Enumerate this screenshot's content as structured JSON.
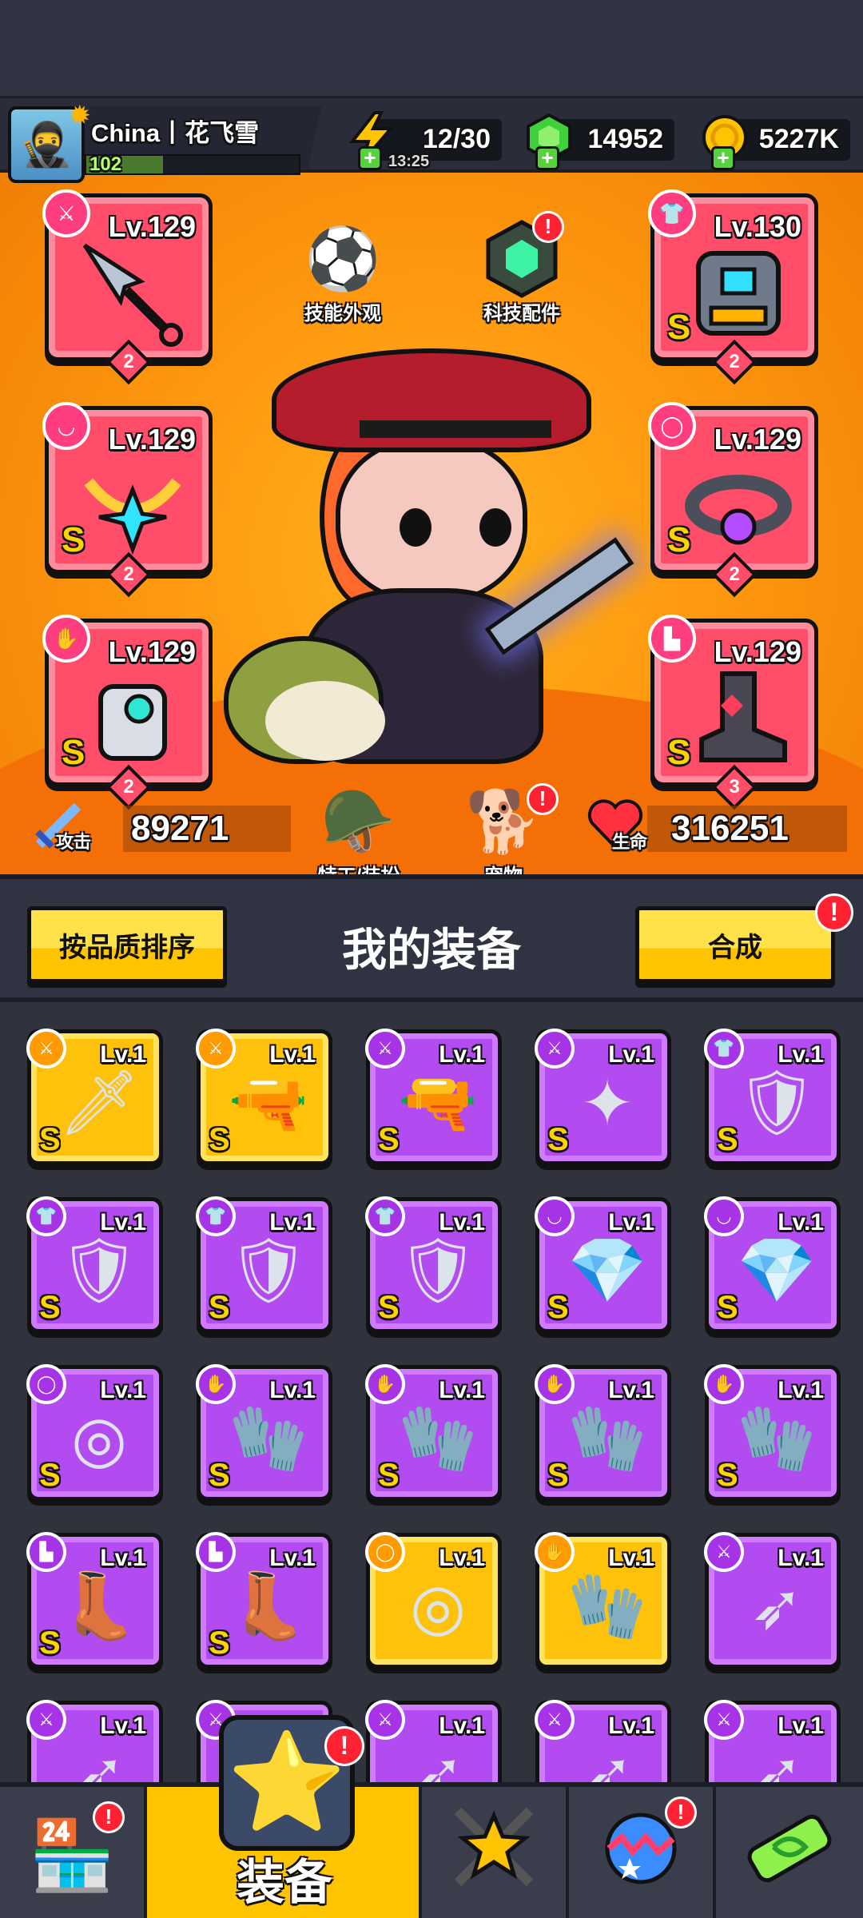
{
  "player": {
    "name": "China丨花飞雪",
    "level": "102",
    "avatar_icon": "ninja-avatar"
  },
  "resources": {
    "energy": {
      "value": "12/30",
      "timer": "13:25",
      "icon": "lightning-icon"
    },
    "gems": {
      "value": "14952",
      "icon": "green-gem-icon"
    },
    "coins": {
      "value": "5227K",
      "icon": "gold-coin-icon"
    }
  },
  "equipped": [
    {
      "slot": "weapon",
      "level": "Lv.129",
      "stars": "2",
      "grade": "",
      "icon": "kunai-icon"
    },
    {
      "slot": "armor",
      "level": "Lv.130",
      "stars": "2",
      "grade": "S",
      "icon": "armor-icon"
    },
    {
      "slot": "necklace",
      "level": "Lv.129",
      "stars": "2",
      "grade": "S",
      "icon": "necklace-icon"
    },
    {
      "slot": "belt",
      "level": "Lv.129",
      "stars": "2",
      "grade": "S",
      "icon": "belt-icon"
    },
    {
      "slot": "gloves",
      "level": "Lv.129",
      "stars": "2",
      "grade": "S",
      "icon": "glove-icon"
    },
    {
      "slot": "boots",
      "level": "Lv.129",
      "stars": "3",
      "grade": "S",
      "icon": "boot-icon"
    }
  ],
  "center_buttons": {
    "skill_skin": "技能外观",
    "tech_parts": "科技配件",
    "agent_outfit": "特工/装扮",
    "pet": "宠物"
  },
  "stats": {
    "attack_label": "攻击",
    "attack_value": "89271",
    "hp_label": "生命",
    "hp_value": "316251"
  },
  "equip_header": {
    "sort_label": "按品质排序",
    "title": "我的装备",
    "merge_label": "合成"
  },
  "inventory": [
    {
      "level": "Lv.1",
      "grade": "S",
      "rarity": "gold",
      "icon": "sword-icon"
    },
    {
      "level": "Lv.1",
      "grade": "S",
      "rarity": "gold",
      "icon": "water-gun-icon"
    },
    {
      "level": "Lv.1",
      "grade": "S",
      "rarity": "purple",
      "icon": "water-gun-icon"
    },
    {
      "level": "Lv.1",
      "grade": "S",
      "rarity": "purple",
      "icon": "shuriken-icon"
    },
    {
      "level": "Lv.1",
      "grade": "S",
      "rarity": "purple",
      "icon": "armor-icon"
    },
    {
      "level": "Lv.1",
      "grade": "S",
      "rarity": "purple",
      "icon": "armor-icon"
    },
    {
      "level": "Lv.1",
      "grade": "S",
      "rarity": "purple",
      "icon": "armor-icon"
    },
    {
      "level": "Lv.1",
      "grade": "S",
      "rarity": "purple",
      "icon": "armor-icon"
    },
    {
      "level": "Lv.1",
      "grade": "S",
      "rarity": "purple",
      "icon": "necklace-icon"
    },
    {
      "level": "Lv.1",
      "grade": "S",
      "rarity": "purple",
      "icon": "necklace-icon"
    },
    {
      "level": "Lv.1",
      "grade": "S",
      "rarity": "purple",
      "icon": "belt-icon"
    },
    {
      "level": "Lv.1",
      "grade": "S",
      "rarity": "purple",
      "icon": "glove-icon"
    },
    {
      "level": "Lv.1",
      "grade": "S",
      "rarity": "purple",
      "icon": "glove-icon"
    },
    {
      "level": "Lv.1",
      "grade": "S",
      "rarity": "purple",
      "icon": "glove-icon"
    },
    {
      "level": "Lv.1",
      "grade": "S",
      "rarity": "purple",
      "icon": "glove-icon"
    },
    {
      "level": "Lv.1",
      "grade": "S",
      "rarity": "purple",
      "icon": "boot-icon"
    },
    {
      "level": "Lv.1",
      "grade": "S",
      "rarity": "purple",
      "icon": "boot-icon"
    },
    {
      "level": "Lv.1",
      "grade": "",
      "rarity": "gold",
      "icon": "belt-icon"
    },
    {
      "level": "Lv.1",
      "grade": "",
      "rarity": "gold",
      "icon": "glove-icon"
    },
    {
      "level": "Lv.1",
      "grade": "",
      "rarity": "purple",
      "icon": "kunai-icon"
    },
    {
      "level": "Lv.1",
      "grade": "",
      "rarity": "purple",
      "icon": "kunai-icon"
    },
    {
      "level": "Lv.1",
      "grade": "",
      "rarity": "purple",
      "icon": "kunai-icon"
    },
    {
      "level": "Lv.1",
      "grade": "",
      "rarity": "purple",
      "icon": "kunai-icon"
    },
    {
      "level": "Lv.1",
      "grade": "",
      "rarity": "purple",
      "icon": "kunai-icon"
    },
    {
      "level": "Lv.1",
      "grade": "",
      "rarity": "purple",
      "icon": "kunai-icon"
    }
  ],
  "bottom_nav": {
    "shop_icon": "shop-icon",
    "equip_label": "装备",
    "hero_icon": "crossed-swords-star-icon",
    "pets_icon": "egg-icon",
    "dna_icon": "dna-capsule-icon"
  },
  "colors": {
    "hero_bg": "#ff9a10",
    "slot_red": "#ff4d6a",
    "item_purple": "#b34cf0",
    "item_gold": "#ffc20a",
    "button_yellow": "#ffc400",
    "alert_red": "#ff2233"
  }
}
